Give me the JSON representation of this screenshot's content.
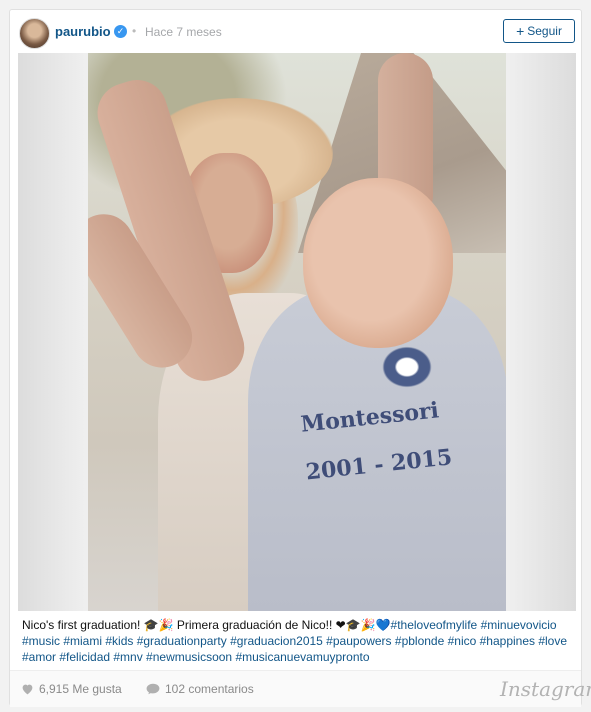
{
  "post": {
    "username": "paurubio",
    "verified_mark": "✓",
    "separator": "•",
    "timestamp": "Hace 7 meses",
    "follow_button": {
      "icon": "plus-icon",
      "icon_glyph": "+",
      "label": "Seguir"
    }
  },
  "photo": {
    "shirt_line1": "Montessori",
    "shirt_line2": "2001 - 2015"
  },
  "caption": {
    "text": "Nico's first graduation! 🎓🎉 Primera graduación de Nico!! ❤🎓🎉💙",
    "hashtags": "#theloveofmylife #minuevovicio #music #miami #kids #graduationparty #graduacion2015 #paupowers #pblonde #nico #happines #love #amor #felicidad #mnv #newmusicsoon #musicanuevamuypronto"
  },
  "footer": {
    "likes": "6,915 Me gusta",
    "comments": "102 comentarios",
    "brand": "Instagram"
  },
  "colors": {
    "link": "#125688",
    "muted": "#a5a7aa",
    "verified": "#3897f0"
  }
}
